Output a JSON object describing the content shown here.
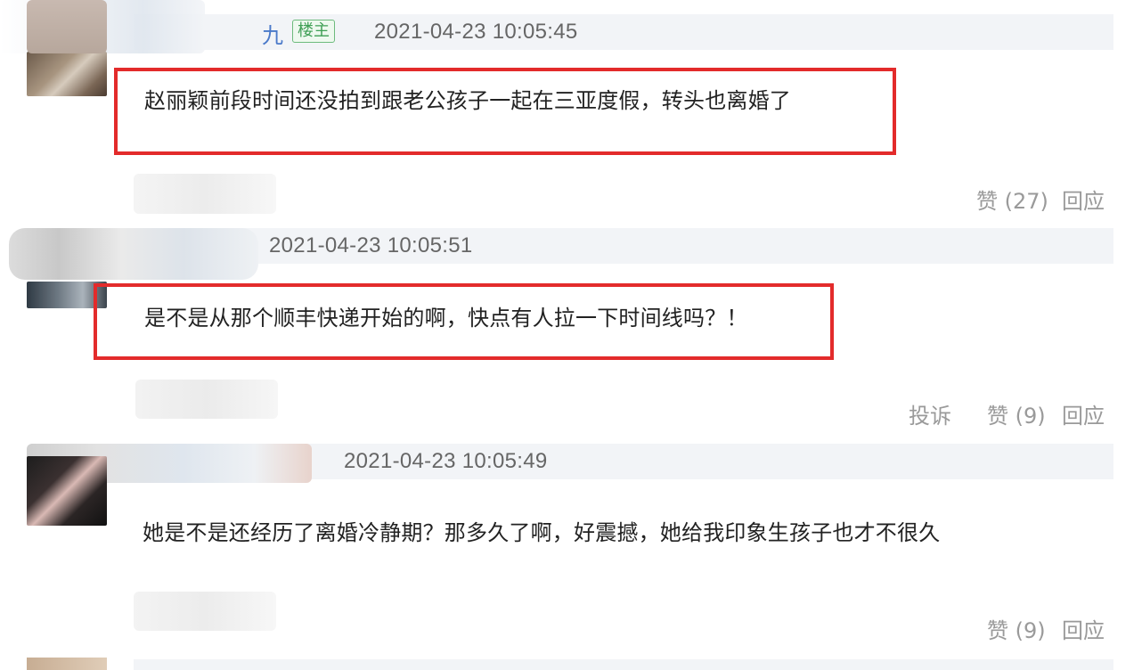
{
  "comments": [
    {
      "username": "九",
      "badge": "楼主",
      "timestamp": "2021-04-23 10:05:45",
      "content": "赵丽颖前段时间还没拍到跟老公孩子一起在三亚度假，转头也离婚了",
      "like_label": "赞 (27)",
      "reply_label": "回应"
    },
    {
      "timestamp": "2021-04-23 10:05:51",
      "content": "是不是从那个顺丰快递开始的啊，快点有人拉一下时间线吗？！",
      "report_label": "投诉",
      "like_label": "赞 (9)",
      "reply_label": "回应"
    },
    {
      "timestamp": "2021-04-23 10:05:49",
      "content": "她是不是还经历了离婚冷静期？那多久了啊，好震撼，她给我印象生孩子也才不很久",
      "like_label": "赞 (9)",
      "reply_label": "回应"
    }
  ],
  "colors": {
    "highlight": "#e32b2b",
    "meta_bar": "#f2f4f7",
    "username": "#4a79c9",
    "badge": "#3f9f55"
  }
}
